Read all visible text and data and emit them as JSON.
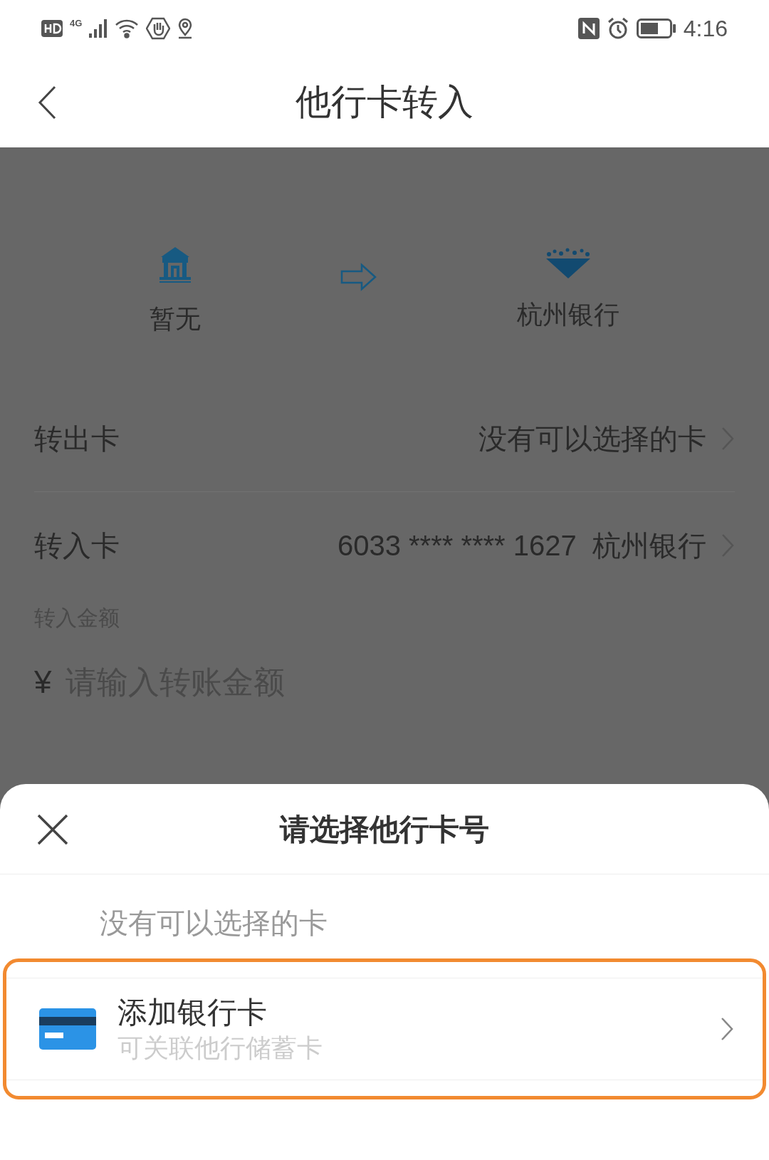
{
  "status_bar": {
    "network": "4G",
    "time": "4:16"
  },
  "header": {
    "title": "他行卡转入"
  },
  "transfer": {
    "from_bank": "暂无",
    "to_bank": "杭州银行"
  },
  "rows": [
    {
      "label": "转出卡",
      "value": "没有可以选择的卡"
    },
    {
      "label": "转入卡",
      "value": "6033 **** **** 1627  杭州银行"
    }
  ],
  "amount": {
    "label": "转入金额",
    "currency": "¥",
    "placeholder": "请输入转账金额"
  },
  "sheet": {
    "title": "请选择他行卡号",
    "empty_text": "没有可以选择的卡",
    "option": {
      "title": "添加银行卡",
      "subtitle": "可关联他行储蓄卡",
      "highlighted": true
    }
  }
}
